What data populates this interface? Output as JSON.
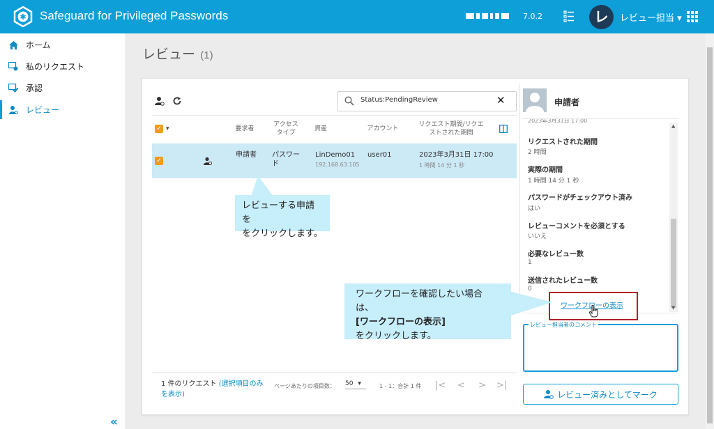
{
  "app": {
    "title": "Safeguard for Privileged Passwords",
    "version": "7.0.2",
    "user_label": "レビュー担当 ▾",
    "avatar_letter": "レ",
    "brand_color": "#0e9fd8"
  },
  "sidebar": {
    "items": [
      {
        "label": "ホーム",
        "icon": "home-icon"
      },
      {
        "label": "私のリクエスト",
        "icon": "my-requests-icon"
      },
      {
        "label": "承認",
        "icon": "approval-icon"
      },
      {
        "label": "レビュー",
        "icon": "review-icon",
        "active": true
      }
    ],
    "collapse_glyph": "«"
  },
  "page": {
    "title": "レビュー",
    "count": "(1)"
  },
  "search": {
    "value": "Status:PendingReview",
    "clear_glyph": "✕"
  },
  "table": {
    "headers": {
      "requester": "要求者",
      "access_type": "アクセス タイプ",
      "asset": "資産",
      "account": "アカウント",
      "request_period": "リクエスト期間/リクエストされた期間"
    },
    "row": {
      "requester": "申請者",
      "access_type": "パスワード",
      "asset": "LinDemo01",
      "asset_ip": "192.168.63.105",
      "account": "user01",
      "date": "2023年3月31日 17:00",
      "duration": "1 時間 14 分 1 秒"
    }
  },
  "footer": {
    "count_text": "1 件のリクエスト",
    "show_selected_link": "(選択項目のみを表示)",
    "per_page_label": "ページあたりの項目数：",
    "per_page_value": "50",
    "range_text": "1 - 1：合計 1 件"
  },
  "details": {
    "title": "申請者",
    "cut_text": "2023年3月31日 17:00",
    "fields": [
      {
        "label": "リクエストされた期間",
        "value": "2 時間"
      },
      {
        "label": "実際の期間",
        "value": "1 時間 14 分 1 秒"
      },
      {
        "label": "パスワードがチェックアウト済み",
        "value": "はい"
      },
      {
        "label": "レビューコメントを必須とする",
        "value": "いいえ"
      },
      {
        "label": "必要なレビュー数",
        "value": "1"
      },
      {
        "label": "送信されたレビュー数",
        "value": "0"
      }
    ],
    "workflow_link": "ワークフローの表示",
    "comment_label": "レビュー担当者のコメント",
    "mark_button": "レビュー済みとしてマーク"
  },
  "callouts": {
    "first_line1": "レビューする申請を",
    "first_line2": "をクリックします。",
    "second_line1": "ワークフローを確認したい場合は、",
    "second_line2": "[ワークフローの表示]",
    "second_line3": "をクリックします。"
  }
}
